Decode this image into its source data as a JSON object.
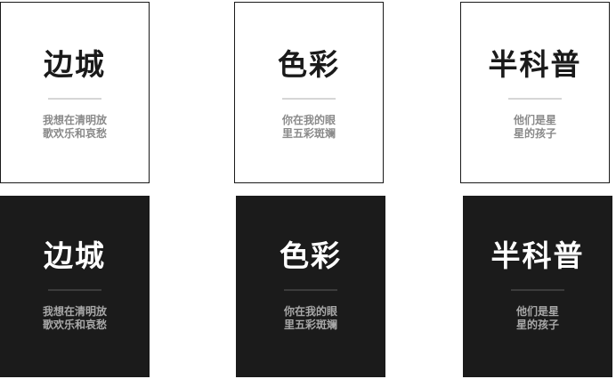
{
  "cards": [
    {
      "theme": "light",
      "title": "边城",
      "lines": [
        "我想在清明放",
        "歌欢乐和哀愁"
      ]
    },
    {
      "theme": "light",
      "title": "色彩",
      "lines": [
        "你在我的眼",
        "里五彩斑斓"
      ]
    },
    {
      "theme": "light",
      "title": "半科普",
      "lines": [
        "他们是星",
        "星的孩子"
      ]
    },
    {
      "theme": "dark",
      "title": "边城",
      "lines": [
        "我想在清明放",
        "歌欢乐和哀愁"
      ]
    },
    {
      "theme": "dark",
      "title": "色彩",
      "lines": [
        "你在我的眼",
        "里五彩斑斓"
      ]
    },
    {
      "theme": "dark",
      "title": "半科普",
      "lines": [
        "他们是星",
        "星的孩子"
      ]
    }
  ],
  "colors": {
    "light_bg": "#ffffff",
    "dark_bg": "#1b1b1b",
    "light_text": "#1a1a1a",
    "dark_text": "#ffffff"
  }
}
